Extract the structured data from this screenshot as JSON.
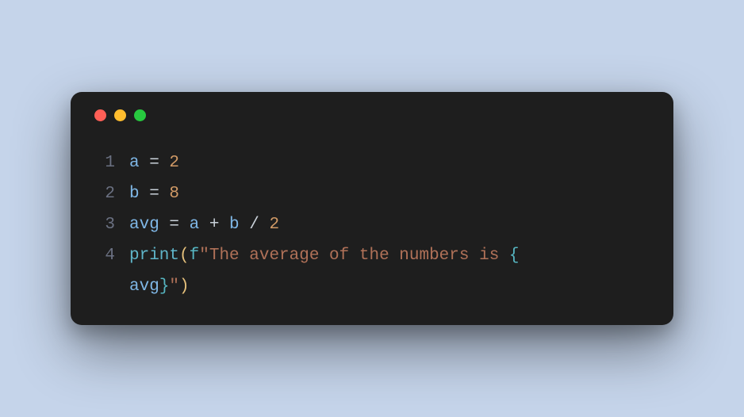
{
  "window": {
    "traffic_lights": [
      "close",
      "minimize",
      "zoom"
    ]
  },
  "code": {
    "lines": [
      {
        "num": "1",
        "tokens": [
          {
            "t": "a",
            "c": "tk-var"
          },
          {
            "t": " = ",
            "c": "tk-op"
          },
          {
            "t": "2",
            "c": "tk-num"
          }
        ]
      },
      {
        "num": "2",
        "tokens": [
          {
            "t": "b",
            "c": "tk-var"
          },
          {
            "t": " = ",
            "c": "tk-op"
          },
          {
            "t": "8",
            "c": "tk-num"
          }
        ]
      },
      {
        "num": "3",
        "tokens": [
          {
            "t": "avg",
            "c": "tk-var"
          },
          {
            "t": " = ",
            "c": "tk-op"
          },
          {
            "t": "a",
            "c": "tk-var"
          },
          {
            "t": " + ",
            "c": "tk-op"
          },
          {
            "t": "b",
            "c": "tk-var"
          },
          {
            "t": " / ",
            "c": "tk-op"
          },
          {
            "t": "2",
            "c": "tk-num"
          }
        ]
      },
      {
        "num": "4",
        "tokens": [
          {
            "t": "print",
            "c": "tk-fn"
          },
          {
            "t": "(",
            "c": "tk-paren"
          },
          {
            "t": "f",
            "c": "tk-fpref"
          },
          {
            "t": "\"The average of the numbers is ",
            "c": "tk-str"
          },
          {
            "t": "{",
            "c": "tk-brace"
          }
        ]
      },
      {
        "num": "",
        "cont": true,
        "tokens": [
          {
            "t": "avg",
            "c": "tk-var"
          },
          {
            "t": "}",
            "c": "tk-brace"
          },
          {
            "t": "\"",
            "c": "tk-str"
          },
          {
            "t": ")",
            "c": "tk-paren"
          }
        ]
      }
    ]
  }
}
